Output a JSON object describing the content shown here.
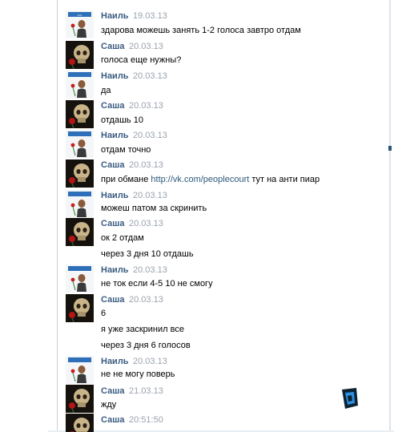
{
  "colors": {
    "author": "#3b5d82",
    "date": "#9aa3ad",
    "link": "#2b587a",
    "divider": "#c5d0dc"
  },
  "messages": [
    {
      "author": "Наиль",
      "date": "19.03.13",
      "avatar": "nail-avatar-icon",
      "lines": [
        "здарова можешь занять 1-2 голоса завтро отдам"
      ]
    },
    {
      "author": "Саша",
      "date": "20.03.13",
      "avatar": "skull-rose-avatar-icon",
      "lines": [
        "голоса еще нужны?"
      ]
    },
    {
      "author": "Наиль",
      "date": "20.03.13",
      "avatar": "nail-avatar-icon",
      "lines": [
        "да"
      ]
    },
    {
      "author": "Саша",
      "date": "20.03.13",
      "avatar": "skull-rose-avatar-icon",
      "lines": [
        "отдашь 10"
      ]
    },
    {
      "author": "Наиль",
      "date": "20.03.13",
      "avatar": "nail-avatar-icon",
      "lines": [
        "отдам точно"
      ]
    },
    {
      "author": "Саша",
      "date": "20.03.13",
      "avatar": "skull-rose-avatar-icon",
      "lines": [],
      "link_message": {
        "before": "при обмане ",
        "link": "http://vk.com/peoplecourt",
        "after": " тут на анти пиар"
      }
    },
    {
      "author": "Наиль",
      "date": "20.03.13",
      "avatar": "nail-avatar-icon",
      "lines": [
        "можеш патом за скринить"
      ]
    },
    {
      "author": "Саша",
      "date": "20.03.13",
      "avatar": "skull-rose-avatar-icon",
      "lines": [
        "ок 2 отдам",
        "через 3 дня 10 отдашь"
      ]
    },
    {
      "author": "Наиль",
      "date": "20.03.13",
      "avatar": "nail-avatar-icon",
      "lines": [
        "не ток если 4-5 10 не смогу"
      ]
    },
    {
      "author": "Саша",
      "date": "20.03.13",
      "avatar": "skull-rose-avatar-icon",
      "lines": [
        "6",
        "я уже заскринил все",
        "через 3 дня 6 голосов"
      ]
    },
    {
      "author": "Наиль",
      "date": "20.03.13",
      "avatar": "nail-avatar-icon",
      "lines": [
        "не не могу поверь"
      ]
    },
    {
      "author": "Саша",
      "date": "21.03.13",
      "avatar": "skull-rose-avatar-icon",
      "lines": [
        "жду"
      ]
    },
    {
      "author": "Саша",
      "date": "20:51:50",
      "avatar": "skull-rose-avatar-icon",
      "lines": []
    }
  ]
}
